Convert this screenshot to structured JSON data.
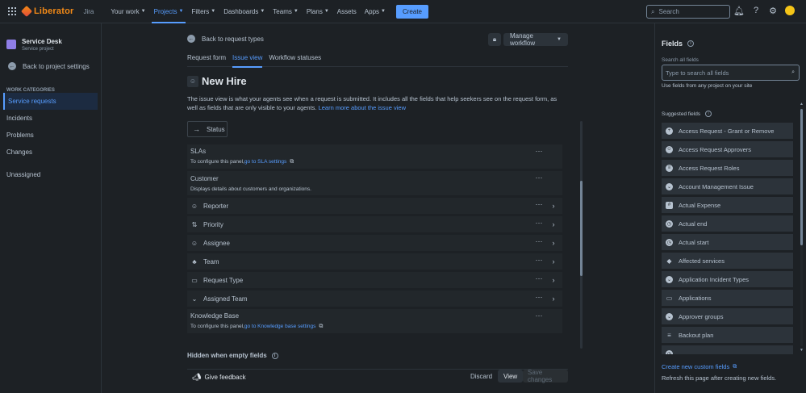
{
  "topnav": {
    "logo": "Liberator",
    "product": "Jira",
    "items": [
      {
        "label": "Your work",
        "caret": true
      },
      {
        "label": "Projects",
        "caret": true,
        "active": true
      },
      {
        "label": "Filters",
        "caret": true
      },
      {
        "label": "Dashboards",
        "caret": true
      },
      {
        "label": "Teams",
        "caret": true
      },
      {
        "label": "Plans",
        "caret": true
      },
      {
        "label": "Assets",
        "caret": false
      },
      {
        "label": "Apps",
        "caret": true
      }
    ],
    "create": "Create",
    "search_placeholder": "Search",
    "icons": [
      "bell-icon",
      "help-icon",
      "settings-icon",
      "avatar"
    ]
  },
  "sidebar": {
    "project_name": "Service Desk",
    "project_type": "Service project",
    "back": "Back to project settings",
    "work_categories": "WORK CATEGORIES",
    "items": [
      "Service requests",
      "Incidents",
      "Problems",
      "Changes"
    ],
    "unassigned": "Unassigned"
  },
  "main": {
    "back": "Back to request types",
    "manage_workflow": "Manage workflow",
    "tabs": [
      "Request form",
      "Issue view",
      "Workflow statuses"
    ],
    "active_tab": 1,
    "title": "New Hire",
    "description": "The issue view is what your agents see when a request is submitted. It includes all the fields that help seekers see on the request form, as well as fields that are only visible to your agents.",
    "learn_more": "Learn more about the issue view",
    "status": "Status",
    "fields": [
      {
        "label": "SLAs",
        "tall": true,
        "sub": "To configure this panel,",
        "sublink": "go to SLA settings",
        "chevron": false
      },
      {
        "label": "Customer",
        "tall": true,
        "sub": "Displays details about customers and organizations.",
        "sublink": "",
        "chevron": false
      },
      {
        "label": "Reporter",
        "icon": "user-icon",
        "glyph": "☺",
        "chevron": true
      },
      {
        "label": "Priority",
        "icon": "priority-icon",
        "glyph": "⇅",
        "chevron": true
      },
      {
        "label": "Assignee",
        "icon": "user-icon",
        "glyph": "☺",
        "chevron": true
      },
      {
        "label": "Team",
        "icon": "team-icon",
        "glyph": "♣",
        "chevron": true
      },
      {
        "label": "Request Type",
        "icon": "folder-icon",
        "glyph": "▭",
        "chevron": true
      },
      {
        "label": "Assigned Team",
        "icon": "dropdown-icon",
        "glyph": "⌄",
        "chevron": true
      },
      {
        "label": "Knowledge Base",
        "tall": true,
        "sub": "To configure this panel,",
        "sublink": "go to Knowledge base settings",
        "chevron": false
      }
    ],
    "hidden_header": "Hidden when empty fields",
    "feedback": "Give feedback",
    "discard": "Discard",
    "view": "View",
    "save": "Save changes"
  },
  "rpanel": {
    "title": "Fields",
    "search_label": "Search all fields",
    "search_placeholder": "Type to search all fields",
    "hint": "Use fields from any project on your site",
    "suggested": "Suggested fields",
    "items": [
      {
        "label": "Access Request - Grant or Remove",
        "glyph": "+",
        "icon": "add-circle-icon"
      },
      {
        "label": "Access Request Approvers",
        "glyph": "☺",
        "icon": "user-icon"
      },
      {
        "label": "Access Request Roles",
        "glyph": "≡",
        "icon": "select-icon"
      },
      {
        "label": "Account Management Issue",
        "glyph": "⌄",
        "icon": "dropdown-icon"
      },
      {
        "label": "Actual Expense",
        "glyph": "#",
        "icon": "number-icon",
        "sq": true
      },
      {
        "label": "Actual end",
        "glyph": "◷",
        "icon": "clock-icon"
      },
      {
        "label": "Actual start",
        "glyph": "◷",
        "icon": "clock-icon"
      },
      {
        "label": "Affected services",
        "glyph": "◆",
        "icon": "tag-icon",
        "plain": true
      },
      {
        "label": "Application Incident Types",
        "glyph": "⌄",
        "icon": "dropdown-icon"
      },
      {
        "label": "Applications",
        "glyph": "▭",
        "icon": "folder-icon",
        "plain": true
      },
      {
        "label": "Approver groups",
        "glyph": "⌄",
        "icon": "dropdown-icon"
      },
      {
        "label": "Backout plan",
        "glyph": "≡",
        "icon": "paragraph-icon",
        "plain": true
      },
      {
        "label": "",
        "glyph": "◷",
        "icon": "clock-icon"
      }
    ],
    "create_link": "Create new custom fields",
    "refresh": "Refresh this page after creating new fields."
  }
}
